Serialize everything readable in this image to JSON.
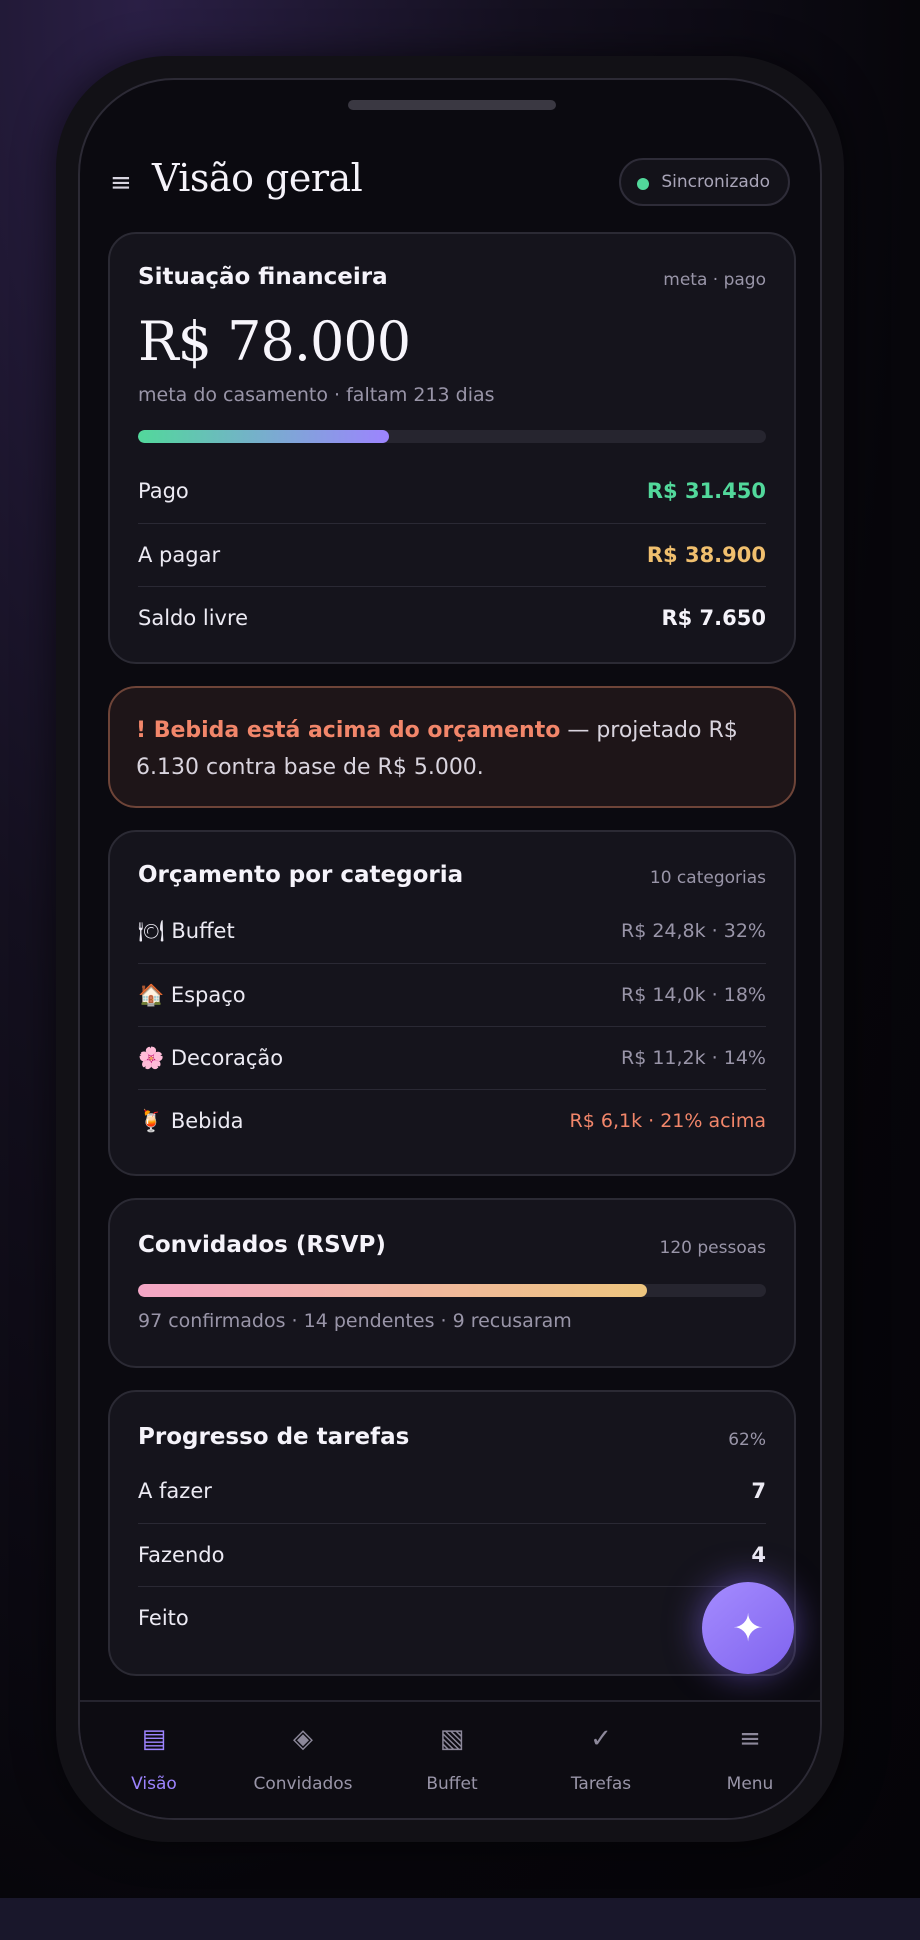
{
  "header": {
    "menu_icon": "≡",
    "title": "Visão geral",
    "sync_status": "Sincronizado"
  },
  "finance": {
    "title": "Situação financeira",
    "meta": "meta · pago",
    "amount": "R$ 78.000",
    "subtitle": "meta do casamento · faltam 213 dias",
    "progress_fraction": 0.4,
    "rows": [
      {
        "label": "Pago",
        "value": "R$ 31.450",
        "color": "#52d89b"
      },
      {
        "label": "A pagar",
        "value": "R$ 38.900",
        "color": "#f0bf6e"
      },
      {
        "label": "Saldo livre",
        "value": "R$ 7.650",
        "color": "#f5f3fa"
      }
    ]
  },
  "alert": {
    "strong": "! Bebida está acima do orçamento",
    "text": " — projetado R$ 6.130 contra base de R$ 5.000."
  },
  "budget": {
    "title": "Orçamento por categoria",
    "meta": "10 categorias",
    "rows": [
      {
        "icon": "🍽",
        "label": "Buffet",
        "value": "R$ 24,8k · 32%",
        "color": "#9995a8"
      },
      {
        "icon": "🏠",
        "label": "Espaço",
        "value": "R$ 14,0k · 18%",
        "color": "#9995a8"
      },
      {
        "icon": "🌸",
        "label": "Decoração",
        "value": "R$ 11,2k · 14%",
        "color": "#9995a8"
      },
      {
        "icon": "🍹",
        "label": "Bebida",
        "value": "R$ 6,1k · 21% acima",
        "color": "#f2866a"
      }
    ]
  },
  "guests": {
    "title": "Convidados (RSVP)",
    "meta": "120 pessoas",
    "confirmed_fraction": 0.81,
    "summary": "97 confirmados · 14 pendentes · 9 recusaram"
  },
  "tasks": {
    "title": "Progresso de tarefas",
    "meta": "62%",
    "rows": [
      {
        "label": "A fazer",
        "value": "7"
      },
      {
        "label": "Fazendo",
        "value": "4"
      },
      {
        "label": "Feito",
        "value": ""
      }
    ]
  },
  "fab_icon": "✦",
  "nav": [
    {
      "icon": "▤",
      "label": "Visão",
      "active": true
    },
    {
      "icon": "◈",
      "label": "Convidados",
      "active": false
    },
    {
      "icon": "▧",
      "label": "Buffet",
      "active": false
    },
    {
      "icon": "✓",
      "label": "Tarefas",
      "active": false
    },
    {
      "icon": "≡",
      "label": "Menu",
      "active": false
    }
  ],
  "colors": {
    "accent": "#9d84ff",
    "paid": "#52d89b",
    "due": "#f0bf6e",
    "warning": "#f2866a"
  }
}
